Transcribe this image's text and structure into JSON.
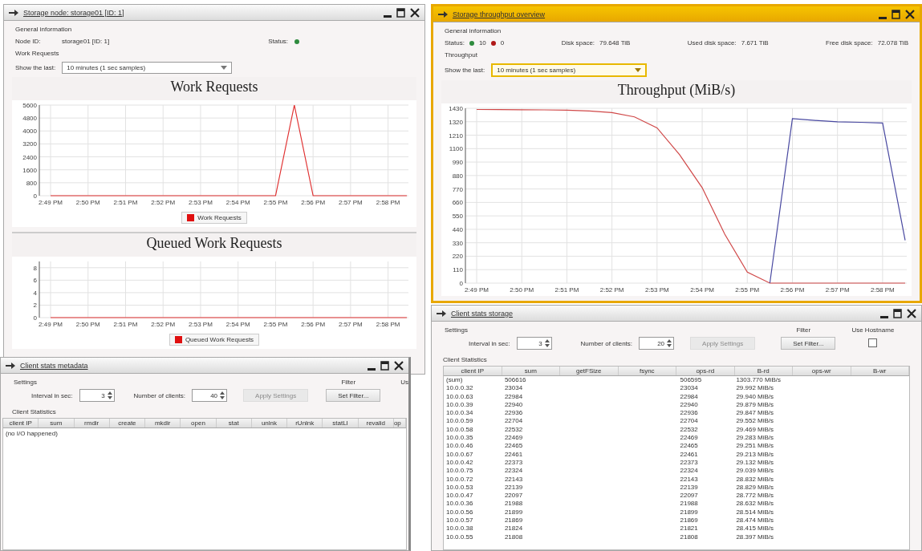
{
  "node_window": {
    "title": "Storage node: storage01 [ID: 1]",
    "active": false,
    "general_heading": "General information",
    "node_label": "Node ID:",
    "node_value": "storage01 [ID: 1]",
    "status_label": "Status:",
    "section_heading": "Work Requests",
    "show_label": "Show the last:",
    "show_value": "10 minutes (1 sec samples)",
    "charts": [
      {
        "chart_data": {
          "type": "line",
          "title": "Work Requests",
          "grid": true,
          "categories": [
            "2:49 PM",
            null,
            "2:50 PM",
            null,
            "2:51 PM",
            null,
            "2:52 PM",
            null,
            "2:53 PM",
            null,
            "2:54 PM",
            null,
            "2:55 PM",
            null,
            "2:56 PM",
            null,
            "2:57 PM",
            null,
            "2:58 PM",
            null
          ],
          "series": [
            {
              "name": "Work Requests",
              "color": "#e03030",
              "values": [
                0,
                0,
                0,
                0,
                0,
                0,
                0,
                0,
                0,
                0,
                0,
                0,
                0,
                5600,
                0,
                0,
                0,
                0,
                0,
                0
              ]
            }
          ],
          "ylim": [
            0,
            5600
          ],
          "yticks": [
            0,
            800,
            1600,
            2400,
            3200,
            4000,
            4800,
            5600
          ]
        }
      },
      {
        "chart_data": {
          "type": "line",
          "title": "Queued Work Requests",
          "grid": true,
          "categories": [
            "2:49 PM",
            null,
            "2:50 PM",
            null,
            "2:51 PM",
            null,
            "2:52 PM",
            null,
            "2:53 PM",
            null,
            "2:54 PM",
            null,
            "2:55 PM",
            null,
            "2:56 PM",
            null,
            "2:57 PM",
            null,
            "2:58 PM",
            null
          ],
          "series": [
            {
              "name": "Queued Work Requests",
              "color": "#e03030",
              "values": [
                0,
                0,
                0,
                0,
                0,
                0,
                0,
                0,
                0,
                0,
                0,
                0,
                0,
                0,
                0,
                0,
                0,
                0,
                0,
                0
              ]
            }
          ],
          "ylim": [
            0,
            9
          ],
          "yticks": [
            0,
            2,
            4,
            6,
            8
          ]
        }
      }
    ]
  },
  "throughput_window": {
    "title": "Storage throughput overview",
    "active": true,
    "general_heading": "General information",
    "status_label": "Status:",
    "statuses": [
      {
        "count": "10",
        "color": "#2e8b3e"
      },
      {
        "count": "0",
        "color": "#b01818"
      }
    ],
    "disk": [
      {
        "label": "Disk space:",
        "value": "79.648 TiB"
      },
      {
        "label": "Used disk space:",
        "value": "7.671 TiB"
      },
      {
        "label": "Free disk space:",
        "value": "72.078 TiB"
      }
    ],
    "section_heading": "Throughput",
    "show_label": "Show the last:",
    "show_value": "10 minutes (1 sec samples)",
    "chart_data": {
      "type": "line",
      "title": "Throughput (MiB/s)",
      "grid": true,
      "categories": [
        "2:49 PM",
        null,
        "2:50 PM",
        null,
        "2:51 PM",
        null,
        "2:52 PM",
        null,
        "2:53 PM",
        null,
        "2:54 PM",
        null,
        "2:55 PM",
        null,
        "2:56 PM",
        null,
        "2:57 PM",
        null,
        "2:58 PM",
        null
      ],
      "series": [
        {
          "color": "#d04848",
          "values": [
            1420,
            1419,
            1418,
            1417,
            1415,
            1408,
            1395,
            1360,
            1270,
            1050,
            780,
            400,
            90,
            0,
            0,
            0,
            0,
            0,
            0,
            0
          ]
        },
        {
          "color": "#4848a0",
          "values": [
            null,
            null,
            null,
            null,
            null,
            null,
            null,
            null,
            null,
            null,
            null,
            null,
            null,
            0,
            1345,
            1330,
            1320,
            1315,
            1310,
            350
          ]
        }
      ],
      "ylim": [
        0,
        1430
      ],
      "yticks": [
        0,
        110,
        220,
        330,
        440,
        550,
        660,
        770,
        880,
        990,
        1100,
        1210,
        1320,
        1430
      ]
    }
  },
  "storage_clients_window": {
    "title": "Client stats storage",
    "active": false,
    "settings_heading": "Settings",
    "interval_label": "Interval in sec:",
    "interval_value": "3",
    "clients_label": "Number of clients:",
    "clients_value": "20",
    "apply_button": "Apply Settings",
    "apply_disabled": true,
    "filter_heading": "Filter",
    "filter_button": "Set Filter...",
    "hostname_label": "Use Hostname",
    "use_hostname": false,
    "stats_heading": "Client Statistics",
    "columns": [
      "client IP",
      "sum",
      "getFSize",
      "fsync",
      "ops-rd",
      "B-rd",
      "ops-wr",
      "B-wr"
    ],
    "rows": [
      {
        "ip": "(sum)",
        "sum": "506616",
        "ops_rd": "506595",
        "b_rd": "1303.770 MiB/s"
      },
      {
        "ip": "10.0.0.32",
        "sum": "23034",
        "ops_rd": "23034",
        "b_rd": "29.992 MiB/s"
      },
      {
        "ip": "10.0.0.63",
        "sum": "22984",
        "ops_rd": "22984",
        "b_rd": "29.940 MiB/s"
      },
      {
        "ip": "10.0.0.39",
        "sum": "22940",
        "ops_rd": "22940",
        "b_rd": "29.879 MiB/s"
      },
      {
        "ip": "10.0.0.34",
        "sum": "22936",
        "ops_rd": "22936",
        "b_rd": "29.847 MiB/s"
      },
      {
        "ip": "10.0.0.59",
        "sum": "22704",
        "ops_rd": "22704",
        "b_rd": "29.552 MiB/s"
      },
      {
        "ip": "10.0.0.58",
        "sum": "22532",
        "ops_rd": "22532",
        "b_rd": "29.469 MiB/s"
      },
      {
        "ip": "10.0.0.35",
        "sum": "22469",
        "ops_rd": "22469",
        "b_rd": "29.283 MiB/s"
      },
      {
        "ip": "10.0.0.46",
        "sum": "22465",
        "ops_rd": "22465",
        "b_rd": "29.251 MiB/s"
      },
      {
        "ip": "10.0.0.67",
        "sum": "22461",
        "ops_rd": "22461",
        "b_rd": "29.213 MiB/s"
      },
      {
        "ip": "10.0.0.42",
        "sum": "22373",
        "ops_rd": "22373",
        "b_rd": "29.132 MiB/s"
      },
      {
        "ip": "10.0.0.75",
        "sum": "22324",
        "ops_rd": "22324",
        "b_rd": "29.039 MiB/s"
      },
      {
        "ip": "10.0.0.72",
        "sum": "22143",
        "ops_rd": "22143",
        "b_rd": "28.832 MiB/s"
      },
      {
        "ip": "10.0.0.53",
        "sum": "22139",
        "ops_rd": "22139",
        "b_rd": "28.829 MiB/s"
      },
      {
        "ip": "10.0.0.47",
        "sum": "22097",
        "ops_rd": "22097",
        "b_rd": "28.772 MiB/s"
      },
      {
        "ip": "10.0.0.36",
        "sum": "21988",
        "ops_rd": "21988",
        "b_rd": "28.632 MiB/s"
      },
      {
        "ip": "10.0.0.56",
        "sum": "21899",
        "ops_rd": "21899",
        "b_rd": "28.514 MiB/s"
      },
      {
        "ip": "10.0.0.57",
        "sum": "21869",
        "ops_rd": "21869",
        "b_rd": "28.474 MiB/s"
      },
      {
        "ip": "10.0.0.38",
        "sum": "21824",
        "ops_rd": "21821",
        "b_rd": "28.415 MiB/s"
      },
      {
        "ip": "10.0.0.55",
        "sum": "21808",
        "ops_rd": "21808",
        "b_rd": "28.397 MiB/s"
      }
    ]
  },
  "metadata_clients_window": {
    "title": "Client stats metadata",
    "active": false,
    "settings_heading": "Settings",
    "interval_label": "Interval in sec:",
    "interval_value": "3",
    "clients_label": "Number of clients:",
    "clients_value": "40",
    "apply_button": "Apply Settings",
    "apply_disabled": true,
    "filter_heading": "Filter",
    "filter_button": "Set Filter...",
    "hostname_label": "Us",
    "stats_heading": "Client Statistics",
    "columns": [
      "client IP",
      "sum",
      "rmdir",
      "create",
      "mkdir",
      "open",
      "stat",
      "unlnk",
      "rUnlnk",
      "statLI",
      "revalid",
      "op"
    ],
    "empty_text": "(no I/O happened)"
  }
}
